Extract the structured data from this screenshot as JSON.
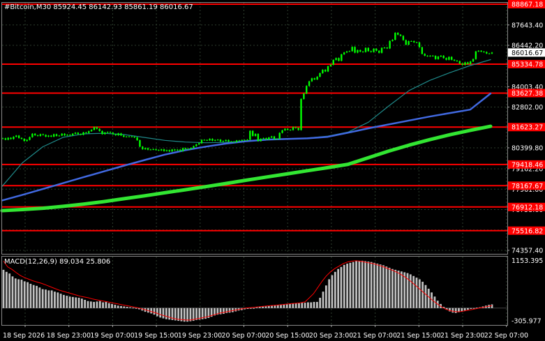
{
  "header": {
    "symbol_line": "#Bitcoin,M30  85924.45 86142.93 85861.19 86016.67"
  },
  "colors": {
    "background": "#000000",
    "grid": "#2e3e2e",
    "candle": "#00ff00",
    "ma_fast": "#1f8a8a",
    "ma_mid": "#4169e1",
    "ma_slow": "#32e632",
    "level_line": "#ff0000",
    "level_tag": "#ff0000",
    "macd_hist": "#c0c0c0",
    "macd_signal": "#ff0000"
  },
  "chart_data": [
    {
      "type": "candlestick",
      "title": "#Bitcoin,M30",
      "ohlc_label": "85924.45 86142.93 85861.19 86016.67",
      "x_labels": [
        "18 Sep 2026",
        "18 Sep 23:00",
        "19 Sep 07:00",
        "19 Sep 15:00",
        "19 Sep 23:00",
        "20 Sep 07:00",
        "20 Sep 15:00",
        "20 Sep 23:00",
        "21 Sep 07:00",
        "21 Sep 15:00",
        "21 Sep 23:00",
        "22 Sep 07:00"
      ],
      "y_ticks": [
        87643.4,
        86442.2,
        84003.4,
        82802.0,
        80399.8,
        79162.2,
        77961.0,
        76758.6,
        75558.6,
        74357.4
      ],
      "ylim": [
        74150,
        88950
      ],
      "current_price": 86016.67,
      "levels": [
        88867.18,
        85334.78,
        83627.38,
        81623.27,
        79418.46,
        78167.67,
        76912.18,
        75516.82
      ],
      "close": [
        80960,
        80880,
        80990,
        80920,
        81050,
        81120,
        80980,
        80930,
        80800,
        80870,
        81030,
        81230,
        81140,
        81100,
        81200,
        81160,
        81060,
        81120,
        81060,
        81200,
        81100,
        81120,
        81230,
        81130,
        81170,
        81140,
        81230,
        81290,
        81210,
        81170,
        81310,
        81270,
        81380,
        81460,
        81620,
        81520,
        81390,
        81210,
        81300,
        81330,
        81290,
        81200,
        81140,
        81250,
        81130,
        81050,
        81060,
        81070,
        81050,
        81010,
        80850,
        80470,
        80320,
        80380,
        80290,
        80300,
        80320,
        80270,
        80250,
        80310,
        80210,
        80260,
        80190,
        80300,
        80250,
        80290,
        80210,
        80380,
        80320,
        80340,
        80390,
        80500,
        80600,
        80670,
        80870,
        80860,
        80840,
        80930,
        80820,
        80860,
        80880,
        80770,
        80800,
        80860,
        80770,
        80760,
        80740,
        80830,
        80810,
        80860,
        80840,
        80880,
        81400,
        81100,
        81220,
        80800,
        80930,
        80970,
        80890,
        81010,
        81070,
        80910,
        80930,
        81280,
        81430,
        81520,
        81460,
        81450,
        81620,
        81570,
        81450,
        83280,
        83600,
        84050,
        84320,
        84500,
        84430,
        84590,
        84800,
        85000,
        84900,
        85210,
        85300,
        85580,
        85690,
        85530,
        85910,
        86020,
        86080,
        86100,
        86350,
        86010,
        86160,
        86070,
        86050,
        86290,
        86100,
        86050,
        86240,
        86120,
        86000,
        86290,
        86310,
        86260,
        86700,
        86770,
        87180,
        87070,
        87000,
        86750,
        86480,
        86690,
        86690,
        86620,
        86610,
        86330,
        85940,
        85830,
        85800,
        85830,
        85820,
        85630,
        85780,
        85830,
        85690,
        85590,
        85760,
        85590,
        85540,
        85510,
        85370,
        85290,
        85440,
        85340,
        85490,
        85630,
        86080,
        86120,
        86070,
        86050,
        85960,
        85960,
        86017
      ],
      "series": [
        {
          "name": "MA fast",
          "values": [
            78130,
            79520,
            80460,
            81020,
            81220,
            81260,
            81180,
            81010,
            80840,
            80740,
            80700,
            80720,
            80800,
            80870,
            80920,
            80980,
            81090,
            81330,
            81910,
            82870,
            83780,
            84370,
            84830,
            85250,
            85600
          ]
        },
        {
          "name": "MA mid",
          "values": [
            77300,
            77630,
            77970,
            78320,
            78670,
            79010,
            79350,
            79680,
            80000,
            80260,
            80470,
            80650,
            80790,
            80880,
            80920,
            80960,
            81050,
            81290,
            81550,
            81780,
            82010,
            82240,
            82450,
            82650,
            83600
          ]
        },
        {
          "name": "MA slow",
          "values": [
            76700,
            76760,
            76840,
            76950,
            77080,
            77230,
            77400,
            77570,
            77750,
            77930,
            78110,
            78300,
            78490,
            78680,
            78860,
            79050,
            79230,
            79430,
            79820,
            80210,
            80560,
            80880,
            81170,
            81430,
            81670
          ]
        }
      ]
    },
    {
      "type": "bar",
      "title": "MACD(12,26,9) 89.034 25.806",
      "name": "MACD(12,26,9)",
      "main_value": 89.034,
      "signal_value": 25.806,
      "y_ticks": [
        1153.395,
        -305.977
      ],
      "ylim": [
        -410,
        1250
      ],
      "histogram": [
        930,
        880,
        840,
        770,
        720,
        700,
        690,
        650,
        630,
        590,
        560,
        540,
        500,
        460,
        450,
        430,
        430,
        400,
        380,
        350,
        320,
        300,
        280,
        270,
        260,
        250,
        230,
        200,
        170,
        160,
        150,
        160,
        170,
        140,
        150,
        120,
        100,
        80,
        60,
        50,
        40,
        30,
        20,
        10,
        -10,
        -30,
        -60,
        -90,
        -110,
        -130,
        -160,
        -200,
        -230,
        -250,
        -270,
        -280,
        -290,
        -300,
        -310,
        -320,
        -330,
        -330,
        -320,
        -310,
        -290,
        -280,
        -270,
        -260,
        -240,
        -210,
        -180,
        -160,
        -150,
        -140,
        -120,
        -110,
        -100,
        -80,
        -60,
        -50,
        -30,
        -20,
        -10,
        0,
        20,
        30,
        40,
        50,
        50,
        60,
        70,
        80,
        80,
        90,
        100,
        100,
        110,
        120,
        120,
        130,
        130,
        140,
        140,
        150,
        150,
        250,
        400,
        550,
        700,
        800,
        880,
        950,
        1000,
        1050,
        1080,
        1100,
        1120,
        1140,
        1150,
        1150,
        1140,
        1130,
        1120,
        1100,
        1080,
        1060,
        1040,
        1010,
        980,
        950,
        930,
        910,
        890,
        870,
        850,
        820,
        780,
        740,
        700,
        640,
        560,
        470,
        380,
        280,
        180,
        100,
        30,
        -40,
        -80,
        -110,
        -120,
        -100,
        -80,
        -60,
        -40,
        -20,
        0,
        10,
        20,
        40,
        60,
        80,
        90
      ],
      "signal": [
        1140,
        1000,
        940,
        860,
        790,
        740,
        700,
        660,
        630,
        600,
        560,
        520,
        480,
        440,
        410,
        380,
        350,
        320,
        290,
        270,
        250,
        220,
        200,
        180,
        160,
        140,
        120,
        100,
        80,
        60,
        40,
        20,
        0,
        -30,
        -60,
        -90,
        -120,
        -160,
        -190,
        -220,
        -250,
        -270,
        -280,
        -290,
        -290,
        -270,
        -250,
        -230,
        -210,
        -180,
        -150,
        -120,
        -100,
        -80,
        -60,
        -40,
        -20,
        0,
        10,
        20,
        30,
        40,
        50,
        60,
        70,
        80,
        90,
        100,
        110,
        120,
        130,
        150,
        250,
        350,
        500,
        650,
        780,
        880,
        960,
        1020,
        1080,
        1120,
        1140,
        1150,
        1140,
        1120,
        1100,
        1080,
        1050,
        1020,
        980,
        940,
        900,
        850,
        790,
        720,
        640,
        550,
        460,
        370,
        280,
        190,
        110,
        40,
        -20,
        -60,
        -80,
        -90,
        -80,
        -60,
        -40,
        -20,
        0,
        20,
        40,
        60
      ]
    }
  ]
}
